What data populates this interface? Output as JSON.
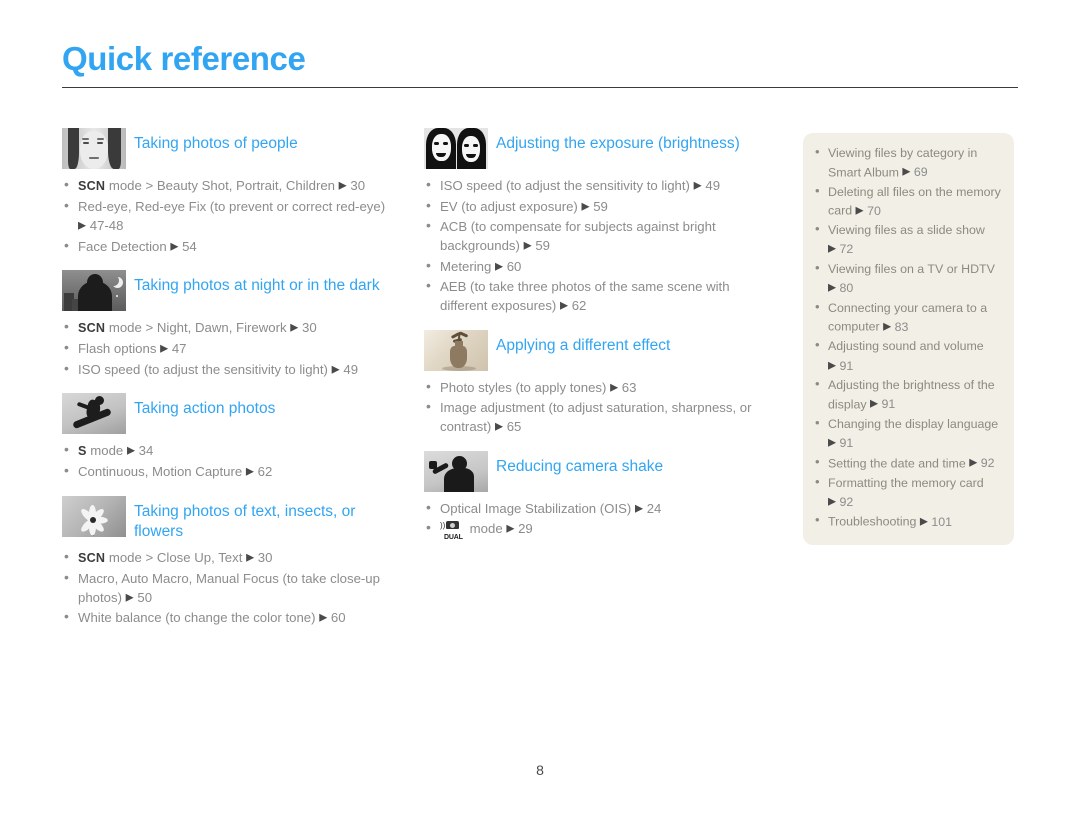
{
  "header": {
    "title": "Quick reference"
  },
  "footer": {
    "page_number": "8"
  },
  "colors": {
    "title_blue": "#32a5f2",
    "body_gray": "#8c8c8c",
    "panel_bg": "#f2efe6",
    "rule": "#3b3b3b"
  },
  "columns": {
    "left": [
      {
        "icon": "portrait-photo-thumbnail",
        "title": "Taking photos of people",
        "items": [
          {
            "mode": "SCN",
            "text": " mode > Beauty Shot, Portrait, Children ",
            "page": "30"
          },
          {
            "mode": "",
            "text": "Red-eye, Red-eye Fix (to prevent or correct red-eye) ",
            "page": "47-48"
          },
          {
            "mode": "",
            "text": "Face Detection ",
            "page": "54"
          }
        ]
      },
      {
        "icon": "night-scene-thumbnail",
        "title": "Taking photos at night or in the dark",
        "items": [
          {
            "mode": "SCN",
            "text": " mode > Night, Dawn, Firework ",
            "page": "30"
          },
          {
            "mode": "",
            "text": "Flash options ",
            "page": "47"
          },
          {
            "mode": "",
            "text": "ISO speed (to adjust the sensitivity to light) ",
            "page": "49"
          }
        ]
      },
      {
        "icon": "snowboarder-action-thumbnail",
        "title": "Taking action photos",
        "items": [
          {
            "mode": "S",
            "text": " mode ",
            "page": "34"
          },
          {
            "mode": "",
            "text": "Continuous, Motion Capture ",
            "page": "62"
          }
        ]
      },
      {
        "icon": "flower-macro-thumbnail",
        "title": "Taking photos of text, insects, or flowers",
        "items": [
          {
            "mode": "SCN",
            "text": " mode > Close Up, Text ",
            "page": "30"
          },
          {
            "mode": "",
            "text": "Macro, Auto Macro, Manual Focus (to take close-up photos) ",
            "page": "50"
          },
          {
            "mode": "",
            "text": "White balance (to change the color tone) ",
            "page": "60"
          }
        ]
      }
    ],
    "middle": [
      {
        "icon": "two-faces-bw-thumbnail",
        "title": "Adjusting the exposure (brightness)",
        "items": [
          {
            "mode": "",
            "text": "ISO speed (to adjust the sensitivity to light) ",
            "page": "49"
          },
          {
            "mode": "",
            "text": "EV (to adjust exposure) ",
            "page": "59"
          },
          {
            "mode": "",
            "text": "ACB (to compensate for subjects against bright backgrounds) ",
            "page": "59"
          },
          {
            "mode": "",
            "text": "Metering ",
            "page": "60"
          },
          {
            "mode": "",
            "text": "AEB (to take three photos of the same scene with different exposures) ",
            "page": "62"
          }
        ]
      },
      {
        "icon": "sepia-vase-thumbnail",
        "title": "Applying a different effect",
        "items": [
          {
            "mode": "",
            "text": "Photo styles (to apply tones) ",
            "page": "63"
          },
          {
            "mode": "",
            "text": "Image adjustment (to adjust saturation, sharpness, or contrast) ",
            "page": "65"
          }
        ]
      },
      {
        "icon": "camera-shake-person-thumbnail",
        "title": "Reducing camera shake",
        "items": [
          {
            "mode": "",
            "text": "Optical Image Stabilization (OIS) ",
            "page": "24"
          },
          {
            "mode": "DUAL_IS_ICON",
            "text": " mode ",
            "page": "29"
          }
        ]
      }
    ]
  },
  "side_panel": {
    "items": [
      {
        "text": "Viewing files by category in Smart Album ",
        "page": "69"
      },
      {
        "text": "Deleting all files on the memory card ",
        "page": "70"
      },
      {
        "text": "Viewing files as a slide show ",
        "page": "72"
      },
      {
        "text": "Viewing files on a TV or HDTV ",
        "page": "80"
      },
      {
        "text": "Connecting your camera to a computer ",
        "page": "83"
      },
      {
        "text": "Adjusting sound and volume ",
        "page": "91"
      },
      {
        "text": "Adjusting the brightness of the display ",
        "page": "91"
      },
      {
        "text": "Changing the display language ",
        "page": "91"
      },
      {
        "text": "Setting the date and time ",
        "page": "92"
      },
      {
        "text": "Formatting the memory card ",
        "page": "92"
      },
      {
        "text": "Troubleshooting ",
        "page": "101"
      }
    ]
  }
}
